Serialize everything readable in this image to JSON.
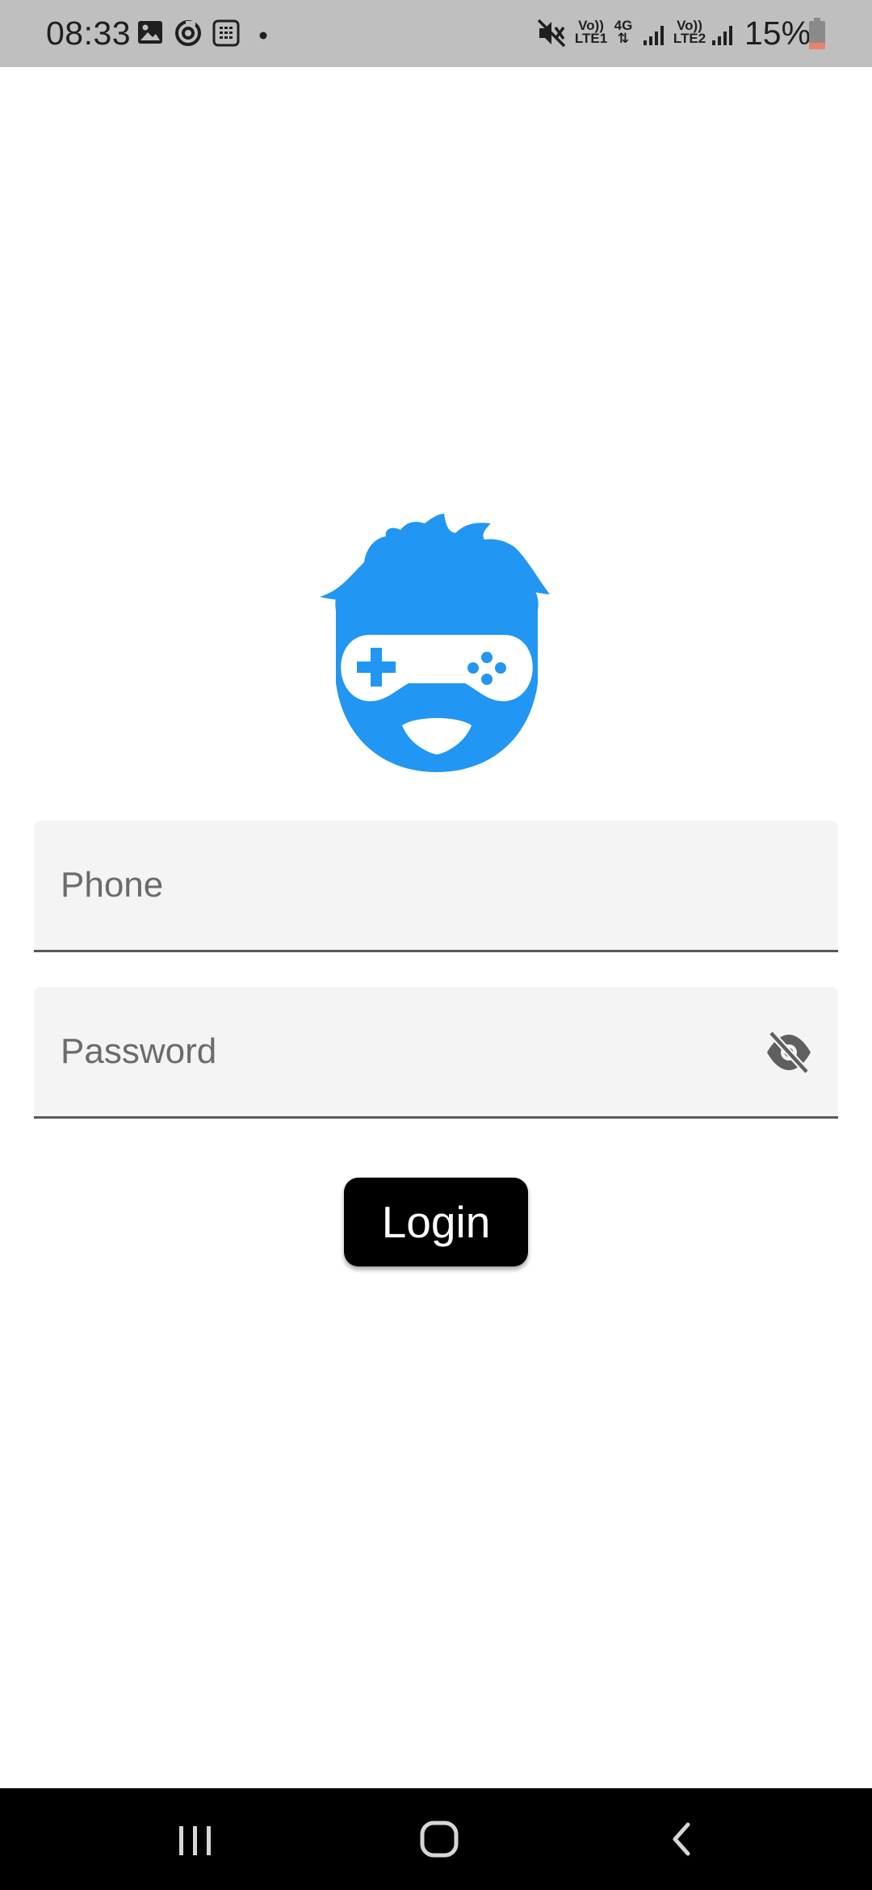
{
  "status_bar": {
    "time": "08:33",
    "sim1_top": "Vo))",
    "sim1_bottom": "LTE1",
    "network_type": "4G",
    "sim2_top": "Vo))",
    "sim2_bottom": "LTE2",
    "battery": "15%"
  },
  "icons": {
    "gallery": "image-icon",
    "sync": "sync-icon",
    "calculator": "calculator-icon",
    "mute": "mute-icon",
    "signal": "signal-icon",
    "battery": "battery-icon",
    "logo": "gamer-logo-icon",
    "eye_off": "eye-off-icon",
    "recents": "recents-icon",
    "home": "home-icon",
    "back": "back-icon"
  },
  "form": {
    "phone_placeholder": "Phone",
    "password_placeholder": "Password",
    "login_label": "Login"
  },
  "colors": {
    "accent": "#2196f3",
    "button": "#000000",
    "field_bg": "#f4f4f4",
    "status_bar": "#bfbfbf",
    "battery_low": "#e8836b"
  }
}
